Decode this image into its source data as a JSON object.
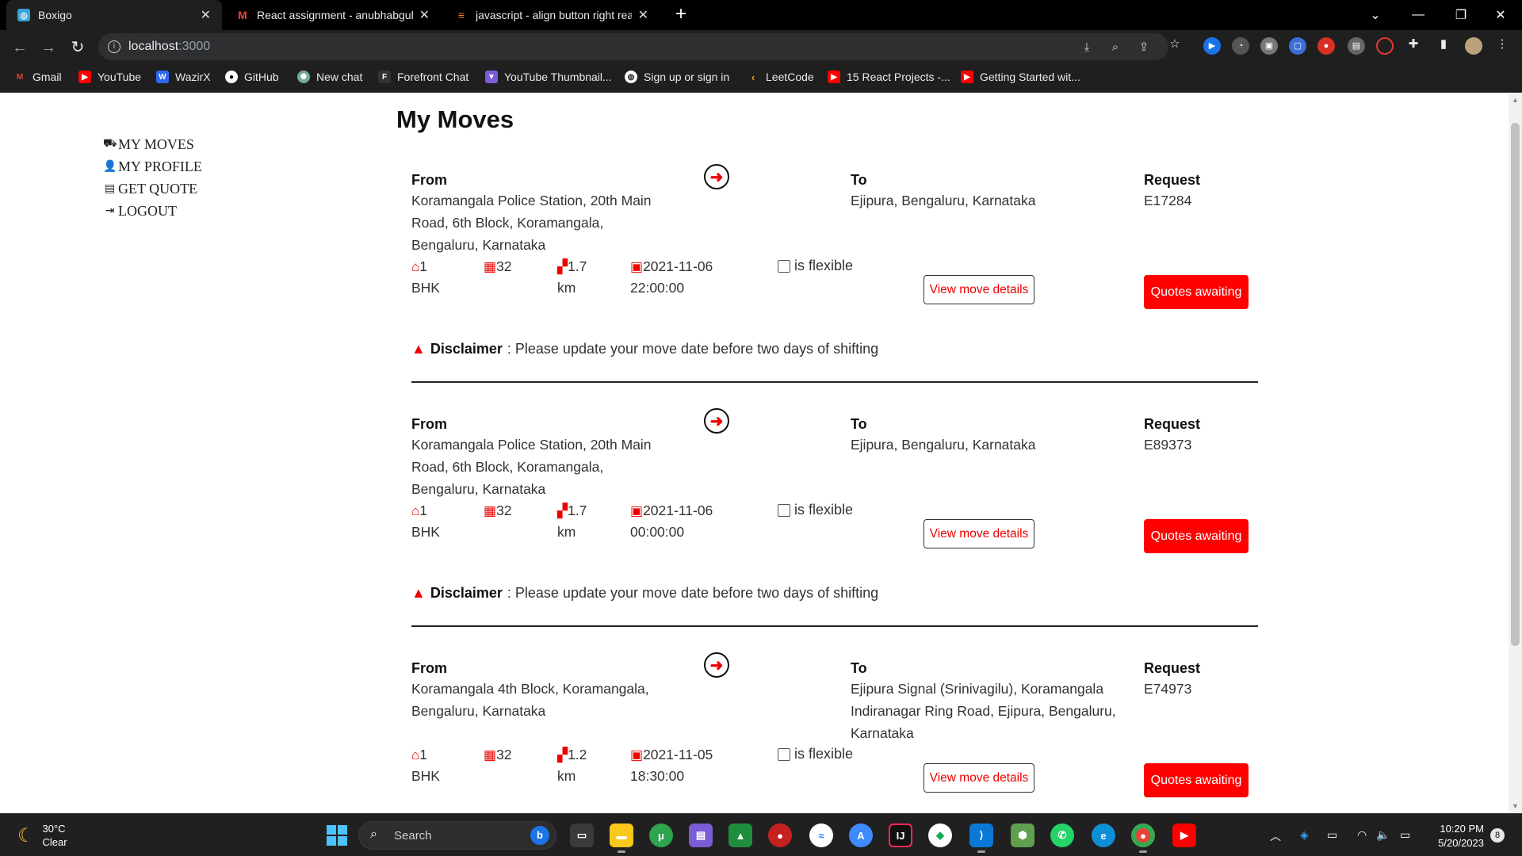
{
  "browser": {
    "tabs": [
      {
        "label": "Boxigo",
        "icon": "boxigo-icon",
        "active": true
      },
      {
        "label": "React assignment - anubhabguh",
        "icon": "gmail-icon",
        "active": false
      },
      {
        "label": "javascript - align button right rea",
        "icon": "stackoverflow-icon",
        "active": false
      }
    ],
    "url_host": "localhost",
    "url_port": ":3000",
    "bookmarks": [
      {
        "label": "Gmail",
        "icon": "gmail-icon",
        "color": "#ea4335"
      },
      {
        "label": "YouTube",
        "icon": "youtube-icon",
        "color": "#ff0000"
      },
      {
        "label": "WazirX",
        "icon": "wazirx-icon",
        "color": "#3067f0"
      },
      {
        "label": "GitHub",
        "icon": "github-icon",
        "color": "#ffffff"
      },
      {
        "label": "New chat",
        "icon": "chatgpt-icon",
        "color": "#74aa9c"
      },
      {
        "label": "Forefront Chat",
        "icon": "forefront-icon",
        "color": "#333333"
      },
      {
        "label": "YouTube Thumbnail...",
        "icon": "thumbnail-icon",
        "color": "#7b5cd6"
      },
      {
        "label": "Sign up or sign in",
        "icon": "globe-icon",
        "color": "#ffffff"
      },
      {
        "label": "LeetCode",
        "icon": "leetcode-icon",
        "color": "#ffa116"
      },
      {
        "label": "15 React Projects -...",
        "icon": "youtube-icon",
        "color": "#ff0000"
      },
      {
        "label": "Getting Started wit...",
        "icon": "youtube-icon",
        "color": "#ff0000"
      }
    ]
  },
  "sidebar": {
    "items": [
      {
        "label": "MY MOVES",
        "icon": "truck-icon"
      },
      {
        "label": "MY PROFILE",
        "icon": "user-icon"
      },
      {
        "label": "GET QUOTE",
        "icon": "document-icon"
      },
      {
        "label": "LOGOUT",
        "icon": "logout-icon"
      }
    ]
  },
  "page": {
    "title": "My Moves",
    "labels": {
      "from": "From",
      "to": "To",
      "request": "Request",
      "flexible": "is flexible",
      "view_button": "View move details",
      "quote_button": "Quotes awaiting",
      "disclaimer_title": "Disclaimer",
      "disclaimer_text": ": Please update your move date before two days of shifting"
    },
    "moves": [
      {
        "from": "Koramangala Police Station, 20th Main Road, 6th Block, Koramangala, Bengaluru, Karnataka",
        "to": "Ejipura, Bengaluru, Karnataka",
        "request": "E17284",
        "property_size": "1\nBHK",
        "items": "32",
        "distance": "1.7\nkm",
        "date": "2021-11-06\n22:00:00"
      },
      {
        "from": "Koramangala Police Station, 20th Main Road, 6th Block, Koramangala, Bengaluru, Karnataka",
        "to": "Ejipura, Bengaluru, Karnataka",
        "request": "E89373",
        "property_size": "1\nBHK",
        "items": "32",
        "distance": "1.7\nkm",
        "date": "2021-11-06\n00:00:00"
      },
      {
        "from": "Koramangala 4th Block, Koramangala, Bengaluru, Karnataka",
        "to": "Ejipura Signal (Srinivagilu), Koramangala Indiranagar Ring Road, Ejipura, Bengaluru, Karnataka",
        "request": "E74973",
        "property_size": "1\nBHK",
        "items": "32",
        "distance": "1.2\nkm",
        "date": "2021-11-05\n18:30:00"
      }
    ]
  },
  "taskbar": {
    "weather_temp": "30°C",
    "weather_desc": "Clear",
    "search_placeholder": "Search",
    "time": "10:20 PM",
    "date": "5/20/2023",
    "notification_count": "8"
  },
  "colors": {
    "accent": "#ff0000",
    "chrome_bg": "#1f1f1f",
    "tabbar_bg": "#000000"
  }
}
